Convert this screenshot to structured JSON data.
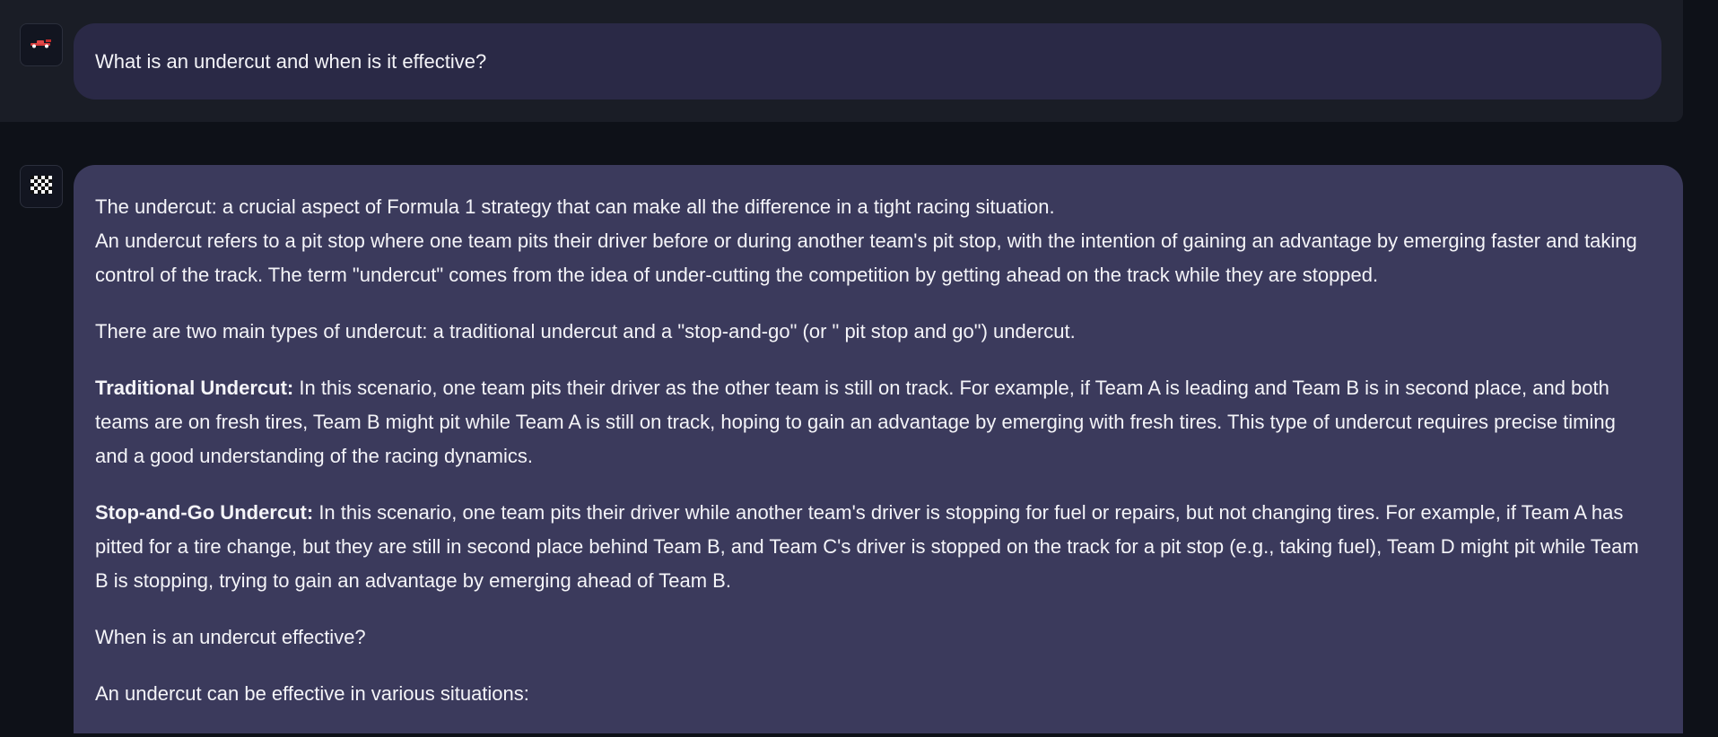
{
  "user_message": {
    "avatar_icon": "race-car-icon",
    "text": "What is an undercut and when is it effective?"
  },
  "assistant_message": {
    "avatar_icon": "checkered-flag-icon",
    "intro_line1": "The undercut: a crucial aspect of Formula 1 strategy that can make all the difference in a tight racing situation.",
    "intro_line2": "An undercut refers to a pit stop where one team pits their driver before or during another team's pit stop, with the intention of gaining an advantage by emerging faster and taking control of the track. The term \"undercut\" comes from the idea of under-cutting the competition by getting ahead on the track while they are stopped.",
    "types_intro": "There are two main types of undercut: a traditional undercut and a \"stop-and-go\" (or \" pit stop and go\") undercut.",
    "traditional_label": "Traditional Undercut:",
    "traditional_text": " In this scenario, one team pits their driver as the other team is still on track. For example, if Team A is leading and Team B is in second place, and both teams are on fresh tires, Team B might pit while Team A is still on track, hoping to gain an advantage by emerging with fresh tires. This type of undercut requires precise timing and a good understanding of the racing dynamics.",
    "stopgo_label": "Stop-and-Go Undercut:",
    "stopgo_text": " In this scenario, one team pits their driver while another team's driver is stopping for fuel or repairs, but not changing tires. For example, if Team A has pitted for a tire change, but they are still in second place behind Team B, and Team C's driver is stopped on the track for a pit stop (e.g., taking fuel), Team D might pit while Team B is stopping, trying to gain an advantage by emerging ahead of Team B.",
    "when_heading": "When is an undercut effective?",
    "situations_intro": "An undercut can be effective in various situations:"
  },
  "colors": {
    "page_bg": "#0e1118",
    "user_row_bg": "#1a1d26",
    "user_bubble_bg": "#2a2946",
    "assistant_bubble_bg": "#3b3a5c",
    "text": "#f4f4f8"
  }
}
